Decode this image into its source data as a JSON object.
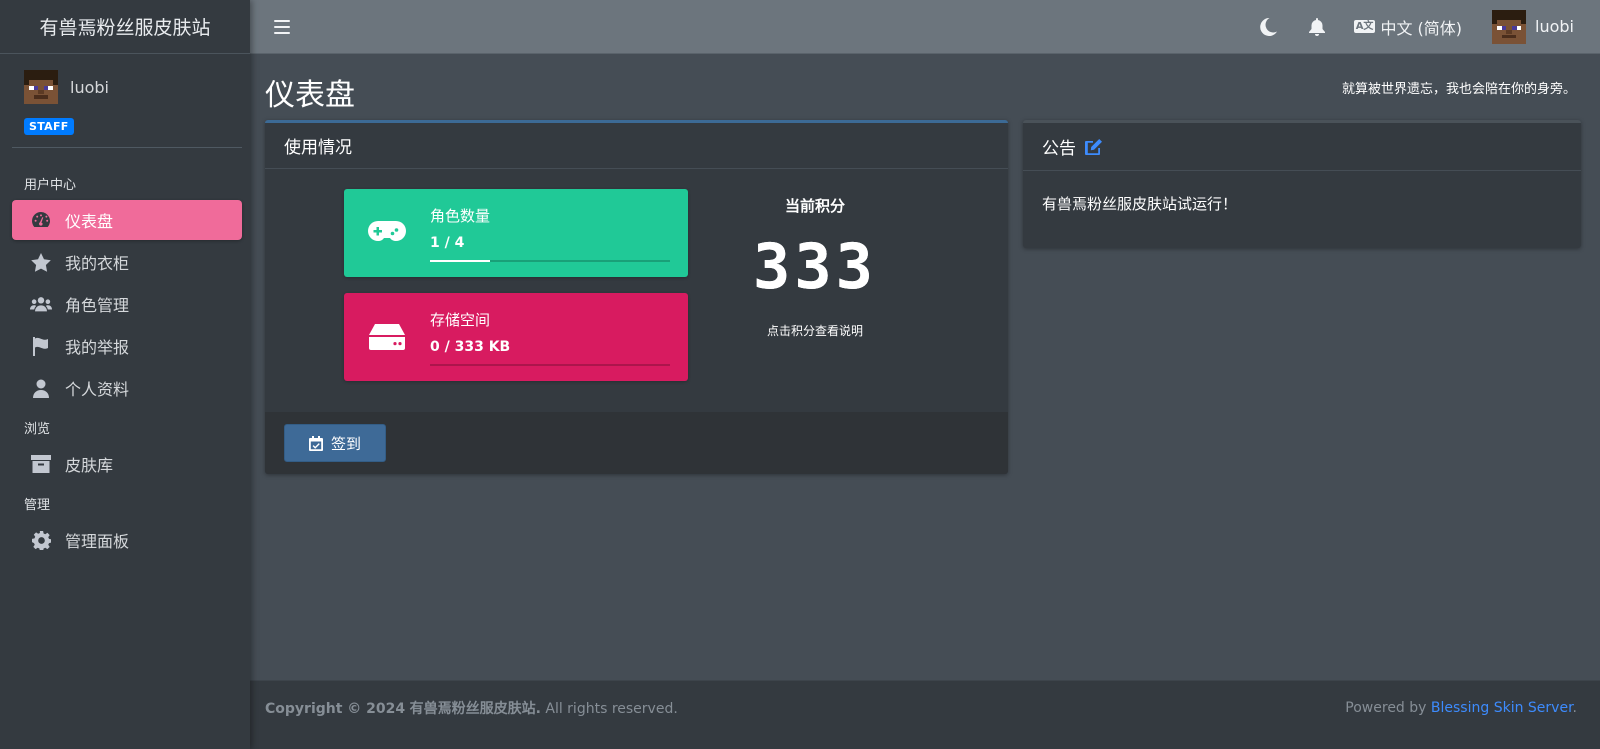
{
  "brand": {
    "title": "有兽焉粉丝服皮肤站"
  },
  "user": {
    "name": "luobi",
    "badge": "STAFF"
  },
  "sidebar": {
    "sections": [
      {
        "header": "用户中心"
      },
      {
        "header": "浏览"
      },
      {
        "header": "管理"
      }
    ],
    "items": [
      {
        "label": "仪表盘",
        "icon": "dashboard-icon",
        "active": true
      },
      {
        "label": "我的衣柜",
        "icon": "star-icon"
      },
      {
        "label": "角色管理",
        "icon": "users-icon"
      },
      {
        "label": "我的举报",
        "icon": "flag-icon"
      },
      {
        "label": "个人资料",
        "icon": "user-icon"
      },
      {
        "label": "皮肤库",
        "icon": "archive-icon"
      },
      {
        "label": "管理面板",
        "icon": "gear-icon"
      }
    ],
    "active_color": "#f06b9a"
  },
  "topbar": {
    "language": "中文 (简体)",
    "language_icon": "A文",
    "user_name": "luobi"
  },
  "page": {
    "title": "仪表盘",
    "motto": "就算被世界遗忘，我也会陪在你的身旁。"
  },
  "usage_card": {
    "title": "使用情况",
    "players": {
      "label": "角色数量",
      "value": "1 / 4",
      "progress": 0.25,
      "color": "#20c997"
    },
    "storage": {
      "label": "存储空间",
      "value": "0 / 333 KB",
      "progress": 0,
      "color": "#d81b60"
    },
    "score": {
      "title": "当前积分",
      "value": "333",
      "hint": "点击积分查看说明"
    },
    "checkin_label": "签到"
  },
  "notice_card": {
    "title": "公告",
    "body": "有兽焉粉丝服皮肤站试运行！"
  },
  "footer": {
    "copyright_prefix": "Copyright © 2024",
    "site_name": "有兽焉粉丝服皮肤站",
    "rights": ". All rights reserved.",
    "powered_prefix": "Powered by",
    "powered_link": "Blessing Skin Server",
    "powered_suffix": "."
  }
}
